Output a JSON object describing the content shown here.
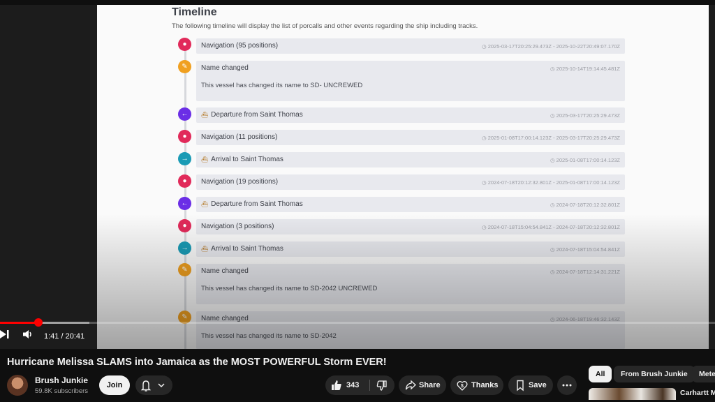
{
  "timeline": {
    "title": "Timeline",
    "description": "The following timeline will display the list of porcalls and other events regarding the ship including tracks.",
    "events": [
      {
        "label": "Navigation (95 positions)",
        "time": "◷ 2025-03-17T20:25:29.473Z - 2025-10-22T20:49:07.170Z",
        "icon": "map-pin-icon",
        "color": "#e12a5a"
      },
      {
        "label": "Name changed",
        "time": "◷ 2025-10-14T19:14:45.481Z",
        "body": "This vessel has changed its name to SD- UNCREWED",
        "icon": "edit-icon",
        "color": "#f0a020"
      },
      {
        "label": "Departure from Saint Thomas",
        "time": "◷ 2025-03-17T20:25:29.473Z",
        "icon": "arrow-left-icon",
        "color": "#6b2ee6"
      },
      {
        "label": "Navigation (11 positions)",
        "time": "◷ 2025-01-08T17:00:14.123Z - 2025-03-17T20:25:29.473Z",
        "icon": "map-pin-icon",
        "color": "#e12a5a"
      },
      {
        "label": "Arrival to Saint Thomas",
        "time": "◷ 2025-01-08T17:00:14.123Z",
        "icon": "arrow-right-icon",
        "color": "#1a9bb5"
      },
      {
        "label": "Navigation (19 positions)",
        "time": "◷ 2024-07-18T20:12:32.801Z - 2025-01-08T17:00:14.123Z",
        "icon": "map-pin-icon",
        "color": "#e12a5a"
      },
      {
        "label": "Departure from Saint Thomas",
        "time": "◷ 2024-07-18T20:12:32.801Z",
        "icon": "arrow-left-icon",
        "color": "#6b2ee6"
      },
      {
        "label": "Navigation (3 positions)",
        "time": "◷ 2024-07-18T15:04:54.841Z - 2024-07-18T20:12:32.801Z",
        "icon": "map-pin-icon",
        "color": "#e12a5a"
      },
      {
        "label": "Arrival to Saint Thomas",
        "time": "◷ 2024-07-18T15:04:54.841Z",
        "icon": "arrow-right-icon",
        "color": "#1a9bb5"
      },
      {
        "label": "Name changed",
        "time": "◷ 2024-07-18T12:14:31.221Z",
        "body": "This vessel has changed its name to SD-2042 UNCREWED",
        "icon": "edit-icon",
        "color": "#f0a020"
      },
      {
        "label": "Name changed",
        "time": "◷ 2024-06-18T19:46:32.143Z",
        "body": "This vessel has changed its name to SD-2042",
        "icon": "edit-icon",
        "color": "#f0a020"
      }
    ]
  },
  "player": {
    "current_time": "1:41",
    "duration": "20:41",
    "time_display": "1:41 / 20:41",
    "progress_fraction": 0.081,
    "buffered_fraction": 0.125
  },
  "video": {
    "title": "Hurricane Melissa SLAMS into Jamaica as the MOST POWERFUL Storm EVER!"
  },
  "channel": {
    "name": "Brush Junkie",
    "subscribers": "59.8K subscribers",
    "join_label": "Join"
  },
  "actions": {
    "likes": "343",
    "share": "Share",
    "thanks": "Thanks",
    "save": "Save"
  },
  "chips": [
    "All",
    "From Brush Junkie",
    "Mete"
  ],
  "recommendation": {
    "title": "Carhartt M"
  }
}
